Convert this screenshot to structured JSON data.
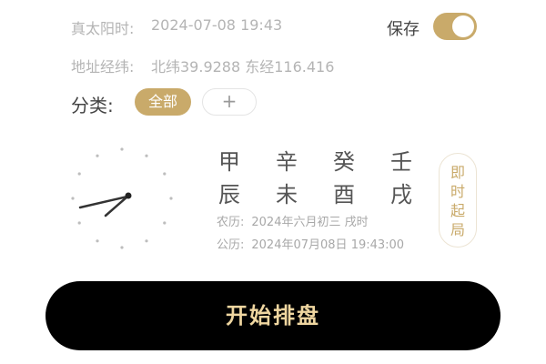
{
  "solar_time": {
    "label": "真太阳时:",
    "value": "2024-07-08 19:43"
  },
  "address": {
    "label": "地址经纬:",
    "value": "北纬39.9288 东经116.416"
  },
  "save": {
    "label": "保存",
    "on": true
  },
  "category": {
    "label": "分类:",
    "all_label": "全部",
    "add_label": "+"
  },
  "bazi": {
    "stems": [
      "甲",
      "辛",
      "癸",
      "壬"
    ],
    "branches": [
      "辰",
      "未",
      "酉",
      "戌"
    ]
  },
  "dates": {
    "lunar_key": "农历:",
    "lunar_value": "2024年六月初三 戌时",
    "solar_key": "公历:",
    "solar_value": "2024年07月08日 19:43:00"
  },
  "clock_icon": "analog-clock-icon",
  "instant_button": {
    "chars": [
      "即",
      "时",
      "起",
      "局"
    ]
  },
  "start_button": {
    "label": "开始排盘"
  },
  "colors": {
    "accent": "#c9aa6a",
    "button_bg": "#000000",
    "button_text": "#efd6a0",
    "muted": "#b4b4b4"
  }
}
